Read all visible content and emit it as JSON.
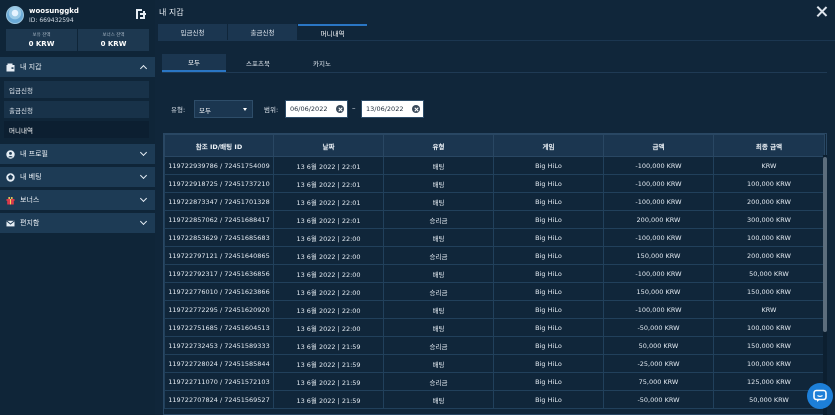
{
  "user": {
    "name": "woosunggkd",
    "id": "ID: 669432594"
  },
  "balances": [
    {
      "label": "보유 잔액",
      "value": "0 KRW"
    },
    {
      "label": "보너스 잔액",
      "value": "0 KRW"
    }
  ],
  "sidebar": {
    "wallet": {
      "label": "내 지갑",
      "items": [
        "입금신청",
        "출금신청",
        "머니내역"
      ]
    },
    "profile": "내 프로필",
    "bets": "내 베팅",
    "bonus": "보너스",
    "mailbox": "편지함"
  },
  "main": {
    "title": "내 지갑",
    "tabs": [
      "입금신청",
      "출금신청",
      "머니내역"
    ],
    "subtabs": [
      "모두",
      "스포츠북",
      "카지노"
    ],
    "filter": {
      "type_label": "유형:",
      "type_value": "모두",
      "range_label": "범위:",
      "date_from": "06/06/2022",
      "date_to": "13/06/2022",
      "separator": "–"
    }
  },
  "table": {
    "columns": [
      "참조 ID/배팅 ID",
      "날짜",
      "유형",
      "게임",
      "금액",
      "최종 금액"
    ],
    "rows": [
      [
        "119722939786 / 72451754009",
        "13 6월 2022 | 22:01",
        "배팅",
        "Big HiLo",
        "-100,000 KRW",
        "KRW"
      ],
      [
        "119722918725 / 72451737210",
        "13 6월 2022 | 22:01",
        "배팅",
        "Big HiLo",
        "-100,000 KRW",
        "100,000 KRW"
      ],
      [
        "119722873347 / 72451701328",
        "13 6월 2022 | 22:01",
        "배팅",
        "Big HiLo",
        "-100,000 KRW",
        "200,000 KRW"
      ],
      [
        "119722857062 / 72451688417",
        "13 6월 2022 | 22:01",
        "승리금",
        "Big HiLo",
        "200,000 KRW",
        "300,000 KRW"
      ],
      [
        "119722853629 / 72451685683",
        "13 6월 2022 | 22:00",
        "배팅",
        "Big HiLo",
        "-100,000 KRW",
        "100,000 KRW"
      ],
      [
        "119722797121 / 72451640865",
        "13 6월 2022 | 22:00",
        "승리금",
        "Big HiLo",
        "150,000 KRW",
        "200,000 KRW"
      ],
      [
        "119722792317 / 72451636856",
        "13 6월 2022 | 22:00",
        "배팅",
        "Big HiLo",
        "-100,000 KRW",
        "50,000 KRW"
      ],
      [
        "119722776010 / 72451623866",
        "13 6월 2022 | 22:00",
        "승리금",
        "Big HiLo",
        "150,000 KRW",
        "150,000 KRW"
      ],
      [
        "119722772295 / 72451620920",
        "13 6월 2022 | 22:00",
        "배팅",
        "Big HiLo",
        "-100,000 KRW",
        "KRW"
      ],
      [
        "119722751685 / 72451604513",
        "13 6월 2022 | 22:00",
        "배팅",
        "Big HiLo",
        "-50,000 KRW",
        "100,000 KRW"
      ],
      [
        "119722732453 / 72451589333",
        "13 6월 2022 | 21:59",
        "승리금",
        "Big HiLo",
        "50,000 KRW",
        "150,000 KRW"
      ],
      [
        "119722728024 / 72451585844",
        "13 6월 2022 | 21:59",
        "배팅",
        "Big HiLo",
        "-25,000 KRW",
        "100,000 KRW"
      ],
      [
        "119722711070 / 72451572103",
        "13 6월 2022 | 21:59",
        "승리금",
        "Big HiLo",
        "75,000 KRW",
        "125,000 KRW"
      ],
      [
        "119722707824 / 72451569527",
        "13 6월 2022 | 21:59",
        "배팅",
        "Big HiLo",
        "-50,000 KRW",
        "50,000 KRW"
      ]
    ]
  },
  "colors": {
    "accent": "#2a76c4",
    "background": "#10263a",
    "panel": "#1b3650",
    "chat": "#1d7fd8"
  },
  "icons": [
    "user-avatar-icon",
    "exchange-icon",
    "wallet-icon",
    "profile-icon",
    "bet-icon",
    "gift-icon",
    "mail-icon",
    "close-icon",
    "chat-icon"
  ]
}
